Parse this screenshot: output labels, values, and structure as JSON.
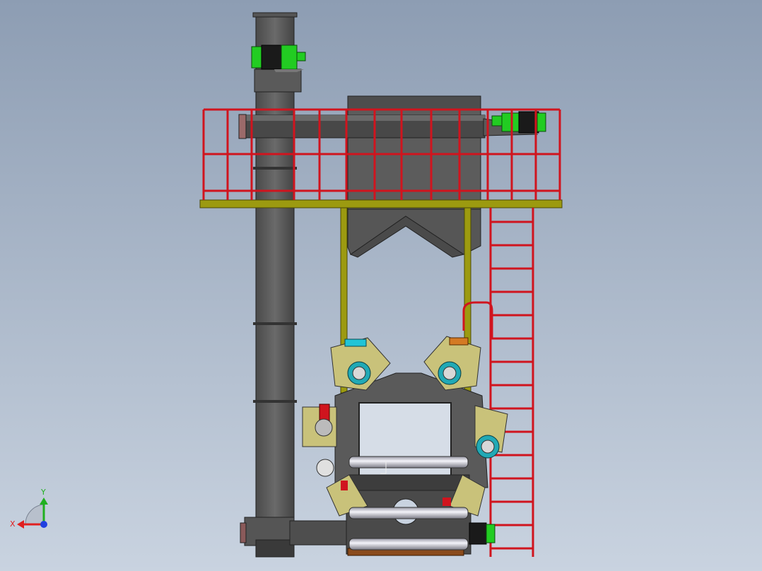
{
  "triad": {
    "x_label": "X",
    "y_label": "Y",
    "x_color": "#e02020",
    "y_color": "#20b020",
    "z_color": "#2040e0"
  },
  "colors": {
    "bg_top": "#8d9db3",
    "bg_bottom": "#c9d3e0",
    "steel": "#5c5c5c",
    "railing": "#d0141e",
    "platform": "#9c9a10",
    "motor_green": "#22cc22",
    "motor_teal": "#21a9b5",
    "plate_tan": "#c9c27a",
    "roller": "#e6e6ee",
    "base": "#8a4b1c"
  }
}
